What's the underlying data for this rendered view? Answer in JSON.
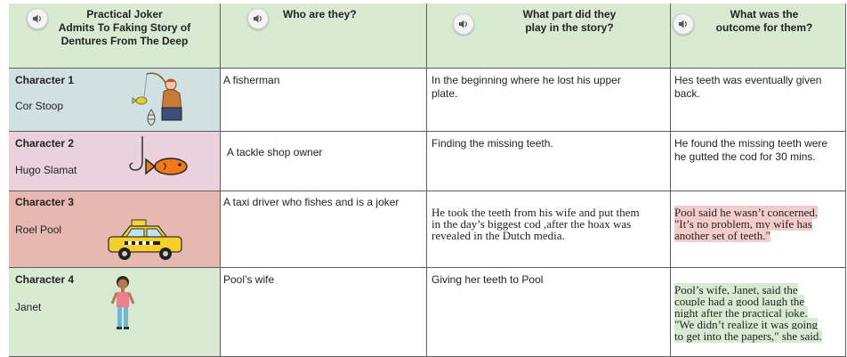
{
  "header": {
    "col1": [
      "Practical Joker",
      "Admits To Faking Story of",
      "Dentures From The Deep"
    ],
    "col2": [
      "Who are they?"
    ],
    "col3": [
      "What part did they",
      "play in the story?"
    ],
    "col4": [
      "What was the",
      "outcome for them?"
    ]
  },
  "rows": [
    {
      "label": "Character 1",
      "name": "Cor Stoop",
      "who": "A fisherman",
      "part": [
        "In the beginning where he lost his upper",
        "plate."
      ],
      "outcome": [
        "Hes teeth was eventually given",
        "back."
      ]
    },
    {
      "label": "Character 2",
      "name": "Hugo Slamat",
      "who": "A tackle shop owner",
      "part": [
        "Finding the missing teeth."
      ],
      "outcome": [
        "He found the missing teeth were",
        "he gutted the cod for 30 mins."
      ]
    },
    {
      "label": "Character 3",
      "name": "Roel Pool",
      "who": "A taxi driver who fishes and is a joker",
      "part": [
        "He took the teeth from his wife and put them",
        "in the day’s biggest cod ,after the hoax was",
        "revealed in the Dutch media."
      ],
      "outcome": [
        "Pool said he wasn’t concerned.",
        "\"It’s no problem, my wife has",
        "another set of teeth.\""
      ]
    },
    {
      "label": "Character 4",
      "name": "Janet",
      "who": "Pool’s wife",
      "part": [
        "Giving her teeth to Pool"
      ],
      "outcome": [
        "Pool’s wife, Janet, said the",
        "couple had a good laugh the",
        "night after the practical joke.",
        "\"We didn’t realize it was going",
        "to get into the papers,\" she said."
      ]
    }
  ],
  "colors": {
    "header_bg": "#d9ead3",
    "row1_bg": "#d0e0e3",
    "row2_bg": "#ead1dc",
    "row3_bg": "#e6b8af",
    "row4_bg": "#d9ead3",
    "highlight_red": "#f4cccc",
    "highlight_green": "#d9ead3"
  },
  "icons": [
    "speaker-icon",
    "fisherman-illustration",
    "fish-on-hook-illustration",
    "taxi-illustration",
    "woman-illustration"
  ]
}
